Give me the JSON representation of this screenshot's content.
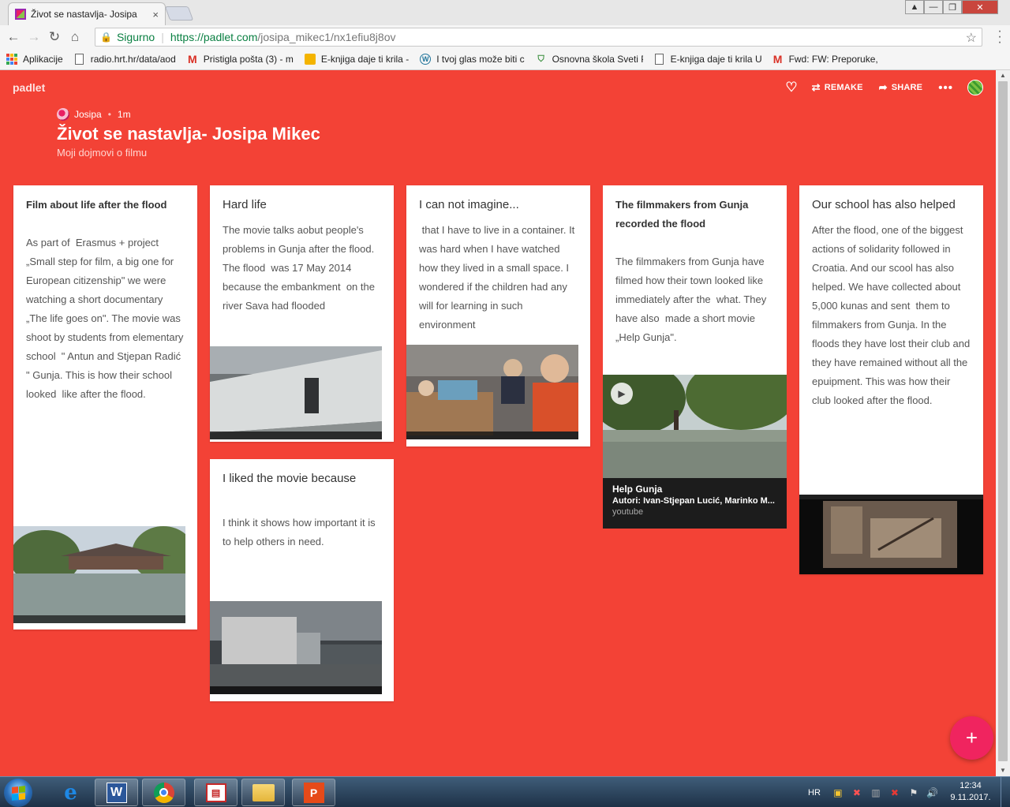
{
  "browser": {
    "tab_title": "Život se nastavlja- Josipa",
    "tab_close": "×",
    "secure_label": "Sigurno",
    "url_scheme": "https://",
    "url_host": "padlet.com",
    "url_path": "/josipa_mikec1/nx1efiu8j8ov",
    "window_controls": [
      "▲",
      "—",
      "❐",
      "✕"
    ],
    "bookmarks": [
      {
        "label": "Aplikacije",
        "icon": "apps-icon"
      },
      {
        "label": "radio.hrt.hr/data/aod",
        "icon": "document-icon"
      },
      {
        "label": "Pristigla pošta (3) - m",
        "icon": "gmail-icon"
      },
      {
        "label": "E-knjiga daje ti krila -",
        "icon": "yellow-book-icon"
      },
      {
        "label": "I tvoj glas može biti c",
        "icon": "wordpress-icon"
      },
      {
        "label": "Osnovna škola Sveti P",
        "icon": "shield-icon"
      },
      {
        "label": "E-knjiga daje ti krila U",
        "icon": "document-icon"
      },
      {
        "label": "Fwd: FW: Preporuke,",
        "icon": "gmail-icon"
      }
    ]
  },
  "padlet": {
    "brand": "padlet",
    "actions": {
      "remake": "REMAKE",
      "share": "SHARE",
      "more": "•••"
    },
    "author": "Josipa",
    "time": "1m",
    "title": "Život se nastavlja- Josipa Mikec",
    "subtitle": "Moji dojmovi o filmu",
    "fab": "+",
    "posts": [
      {
        "title": "Film about life after the flood",
        "body": "As part of  Erasmus + project „Small step for film, a big one for European citizenship\" we were watching a short documentary  „The life goes on\". The movie was shoot by students from elementary school  \" Antun and Stjepan Radić \" Gunja. This is how their school looked  like after the flood."
      },
      {
        "title": "Hard life",
        "body": "The movie talks aobut people's problems in Gunja after the flood. The flood  was 17 May 2014  because the embankment  on the river Sava had flooded"
      },
      {
        "title": "I liked the movie because",
        "body": "I think it shows how important it is to help others in need."
      },
      {
        "title": "I can not imagine...",
        "body": " that I have to live in a container. It was hard when I have watched how they lived in a small space. I wondered if the children had any will for learning in such environment"
      },
      {
        "title": "The filmmakers from Gunja recorded the flood",
        "body": "The filmmakers from Gunja have filmed how their town looked like immediately after the  what. They have also  made a short movie „Help Gunja\".",
        "embed": {
          "title": "Help Gunja",
          "author": "Autori: Ivan-Stjepan Lucić, Marinko M...",
          "source": "youtube"
        }
      },
      {
        "title": "Our school  has also helped",
        "body": "After the flood, one of the biggest actions of solidarity followed in Croatia. And our scool has also helped. We have collected about 5,000 kunas and sent  them to filmmakers from Gunja. In the floods they have lost their club and they have remained without all the epuipment. This was how their club looked after the flood."
      }
    ]
  },
  "taskbar": {
    "language": "HR",
    "time": "12:34",
    "date": "9.11.2017."
  }
}
